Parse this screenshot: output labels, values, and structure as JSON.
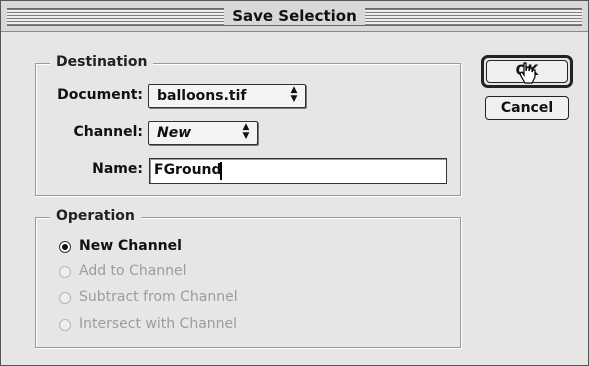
{
  "dialog": {
    "title": "Save Selection"
  },
  "destination": {
    "legend": "Destination",
    "document_label": "Document:",
    "document_value": "balloons.tif",
    "channel_label": "Channel:",
    "channel_value": "New",
    "name_label": "Name:",
    "name_value": "FGround"
  },
  "operation": {
    "legend": "Operation",
    "options": [
      {
        "label": "New Channel",
        "selected": true,
        "enabled": true
      },
      {
        "label": "Add to Channel",
        "selected": false,
        "enabled": false
      },
      {
        "label": "Subtract from Channel",
        "selected": false,
        "enabled": false
      },
      {
        "label": "Intersect with Channel",
        "selected": false,
        "enabled": false
      }
    ]
  },
  "buttons": {
    "ok_label": "OK",
    "cancel_label": "Cancel"
  },
  "icons": {
    "popup_arrows": "up-down-arrows-icon",
    "cursor": "hand-pointer-icon"
  },
  "colors": {
    "dialog_bg": "#e6e6e6",
    "text": "#111111",
    "disabled_text": "#9c9c9c"
  }
}
